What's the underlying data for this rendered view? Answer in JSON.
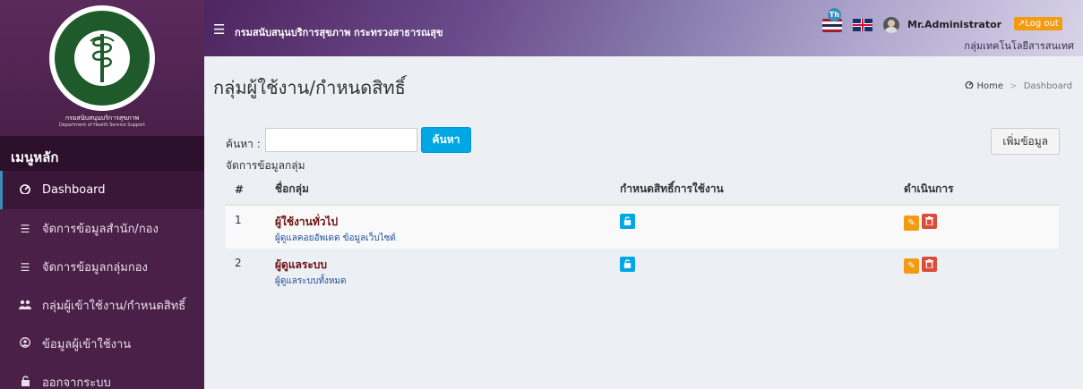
{
  "sidebar": {
    "org_name": "กรมสนับสนุนบริการสุขภาพ",
    "org_sub": "Department of Health Service Support",
    "menu_header": "เมนูหลัก",
    "items": [
      {
        "label": "Dashboard",
        "icon": "dashboard-icon"
      },
      {
        "label": "จัดการข้อมูลสำนัก/กอง",
        "icon": "list-icon"
      },
      {
        "label": "จัดการข้อมูลกลุ่มกอง",
        "icon": "list-icon"
      },
      {
        "label": "กลุ่มผู้เข้าใช้งาน/กำหนดสิทธิ์",
        "icon": "users-icon"
      },
      {
        "label": "ข้อมูลผู้เข้าใช้งาน",
        "icon": "user-circle-icon"
      },
      {
        "label": "ออกจากระบบ",
        "icon": "unlock-icon"
      }
    ]
  },
  "topbar": {
    "title": "กรมสนับสนุนบริการสุขภาพ กระทรวงสาธารณสุข",
    "lang_badge": "Th",
    "user_name": "Mr.Administrator",
    "logout_label": "Log out",
    "user_group": "กลุ่มเทคโนโลยีสารสนเทศ"
  },
  "page": {
    "title": "กลุ่มผู้ใช้งาน/กำหนดสิทธิ์",
    "breadcrumb": [
      "Home",
      "Dashboard"
    ],
    "search_label": "ค้นหา :",
    "search_value": "",
    "search_button": "ค้นหา",
    "add_button": "เพิ่มข้อมูล",
    "section_label": "จัดการข้อมูลกลุ่ม"
  },
  "table": {
    "headers": [
      "#",
      "ชื่อกลุ่ม",
      "กำหนดสิทธิ์การใช้งาน",
      "ดำเนินการ"
    ],
    "rows": [
      {
        "no": "1",
        "name": "ผู้ใช้งานทั่วไป",
        "desc": "ผู้ดูแลคอยอัพเดต ข้อมูลเว็บไซต์"
      },
      {
        "no": "2",
        "name": "ผู้ดูแลระบบ",
        "desc": "ผู้ดูแลระบบทั้งหมด"
      }
    ]
  },
  "colors": {
    "sidebar_bg": "#4a1f48",
    "accent": "#00a7e5",
    "edit": "#f39c12",
    "delete": "#dd4b39"
  }
}
